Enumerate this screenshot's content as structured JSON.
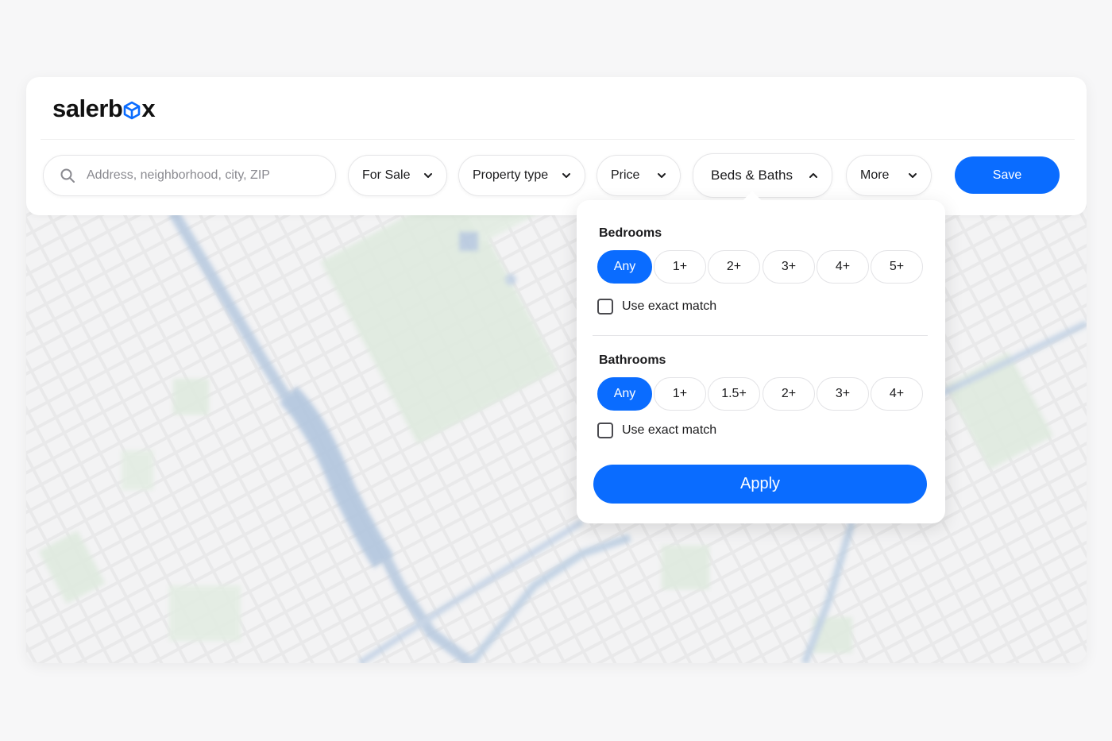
{
  "brand": {
    "name_prefix": "salerb",
    "name_suffix": "x",
    "accent": "#0a6cff"
  },
  "search": {
    "placeholder": "Address, neighborhood, city, ZIP",
    "icon": "search-icon"
  },
  "filters": {
    "listing_type": "For Sale",
    "property_type": "Property type",
    "price": "Price",
    "beds_baths": "Beds & Baths",
    "more": "More",
    "save_label": "Save"
  },
  "dropdown": {
    "bedrooms": {
      "title": "Bedrooms",
      "options": [
        "Any",
        "1+",
        "2+",
        "3+",
        "4+",
        "5+"
      ],
      "selected": "Any",
      "exact_match_label": "Use exact match",
      "exact_match_checked": false
    },
    "bathrooms": {
      "title": "Bathrooms",
      "options": [
        "Any",
        "1+",
        "1.5+",
        "2+",
        "3+",
        "4+"
      ],
      "selected": "Any",
      "exact_match_label": "Use exact match",
      "exact_match_checked": false
    },
    "apply_label": "Apply"
  }
}
